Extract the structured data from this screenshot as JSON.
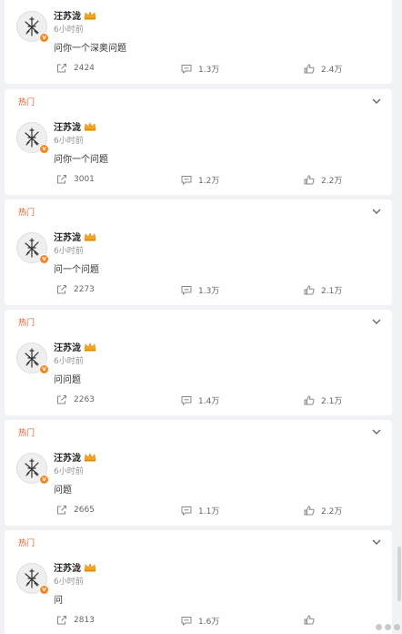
{
  "colors": {
    "hot": "#e85a2b",
    "badge": "#f4871f",
    "text": "#333333",
    "muted": "#939393"
  },
  "icons": {
    "share": "share-icon",
    "comment": "comment-icon",
    "like": "like-icon",
    "collapse": "chevron-down-icon",
    "verified": "verified-badge-icon",
    "crown": "crown-icon"
  },
  "posts": [
    {
      "hot_label": "",
      "author": "汪苏泷",
      "time": "6小时前",
      "text": "问你一个深奥问题",
      "shares": "2424",
      "comments": "1.3万",
      "likes": "2.4万"
    },
    {
      "hot_label": "热门",
      "author": "汪苏泷",
      "time": "6小时前",
      "text": "问你一个问题",
      "shares": "3001",
      "comments": "1.2万",
      "likes": "2.2万"
    },
    {
      "hot_label": "热门",
      "author": "汪苏泷",
      "time": "6小时前",
      "text": "问一个问题",
      "shares": "2273",
      "comments": "1.3万",
      "likes": "2.1万"
    },
    {
      "hot_label": "热门",
      "author": "汪苏泷",
      "time": "6小时前",
      "text": "问问题",
      "shares": "2263",
      "comments": "1.4万",
      "likes": "2.1万"
    },
    {
      "hot_label": "热门",
      "author": "汪苏泷",
      "time": "6小时前",
      "text": "问题",
      "shares": "2665",
      "comments": "1.1万",
      "likes": "2.2万"
    },
    {
      "hot_label": "热门",
      "author": "汪苏泷",
      "time": "6小时前",
      "text": "问",
      "shares": "2813",
      "comments": "1.6万",
      "likes": ""
    }
  ]
}
